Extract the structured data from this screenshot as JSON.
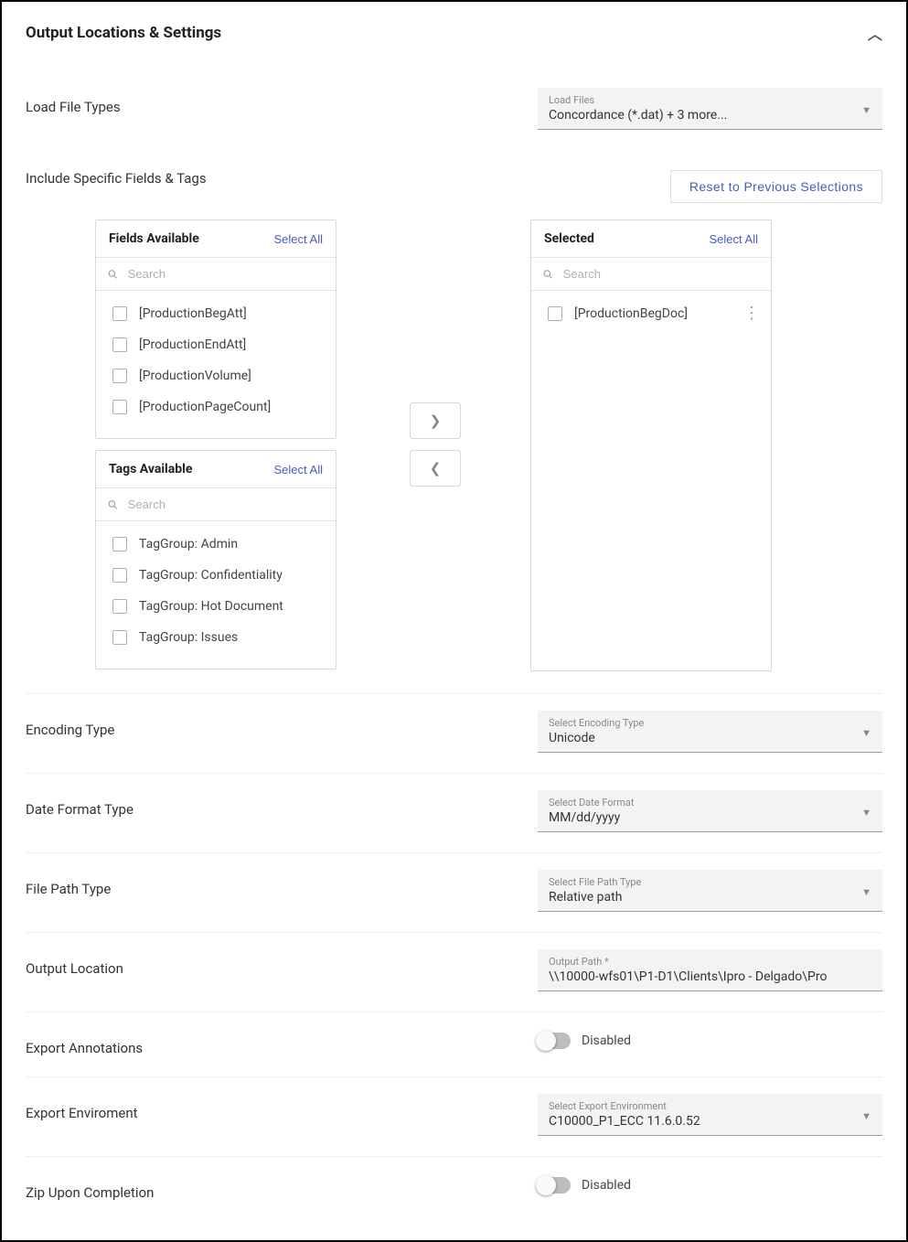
{
  "header": {
    "title": "Output Locations & Settings"
  },
  "searchPlaceholder": "Search",
  "loadFiles": {
    "label": "Load File Types",
    "floating": "Load Files",
    "value": "Concordance (*.dat) + 3 more..."
  },
  "includeFields": {
    "label": "Include Specific Fields & Tags",
    "reset": "Reset to Previous Selections",
    "fieldsPanel": {
      "title": "Fields Available",
      "selectAll": "Select All",
      "items": [
        "[ProductionBegAtt]",
        "[ProductionEndAtt]",
        "[ProductionVolume]",
        "[ProductionPageCount]"
      ]
    },
    "tagsPanel": {
      "title": "Tags Available",
      "selectAll": "Select All",
      "items": [
        "TagGroup: Admin",
        "TagGroup: Confidentiality",
        "TagGroup: Hot Document",
        "TagGroup: Issues"
      ]
    },
    "selectedPanel": {
      "title": "Selected",
      "selectAll": "Select All",
      "items": [
        "[ProductionBegDoc]"
      ]
    }
  },
  "encoding": {
    "label": "Encoding Type",
    "floating": "Select Encoding Type",
    "value": "Unicode"
  },
  "dateFormat": {
    "label": "Date Format Type",
    "floating": "Select Date Format",
    "value": "MM/dd/yyyy"
  },
  "filePath": {
    "label": "File Path Type",
    "floating": "Select File Path Type",
    "value": "Relative path"
  },
  "outputLoc": {
    "label": "Output Location",
    "floating": "Output Path *",
    "value": "\\\\10000-wfs01\\P1-D1\\Clients\\Ipro - Delgado\\Pro"
  },
  "annotations": {
    "label": "Export Annotations",
    "state": "Disabled"
  },
  "environment": {
    "label": "Export Enviroment",
    "floating": "Select Export Environment",
    "value": "C10000_P1_ECC   11.6.0.52"
  },
  "zip": {
    "label": "Zip Upon Completion",
    "state": "Disabled"
  }
}
